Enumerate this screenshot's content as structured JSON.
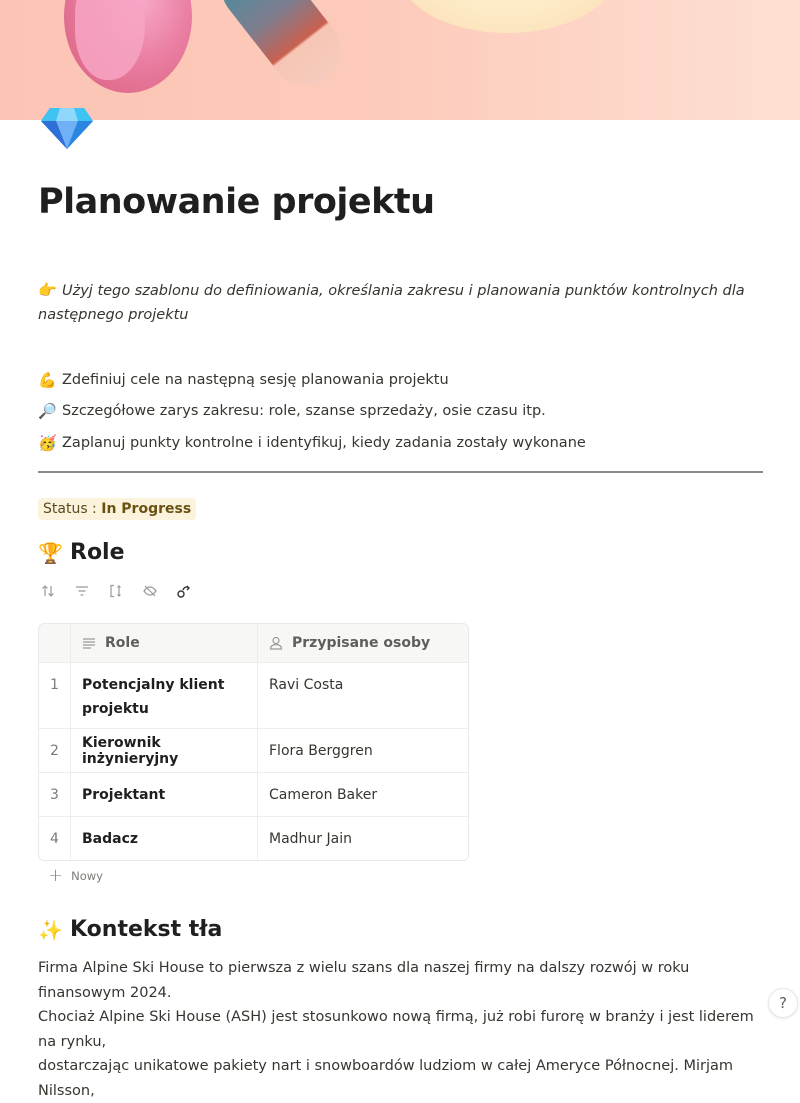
{
  "page": {
    "icon": "gem-icon",
    "title": "Planowanie projektu",
    "intro": {
      "emoji": "👉",
      "text": "Użyj tego szablonu do definiowania, określania zakresu i planowania punktów kontrolnych dla następnego projektu"
    },
    "bullets": [
      {
        "emoji": "💪",
        "text": "Zdefiniuj cele na następną sesję planowania projektu"
      },
      {
        "emoji": "🔎",
        "text": "Szczegółowe zarys zakresu: role, szanse sprzedaży, osie czasu itp."
      },
      {
        "emoji": "🥳",
        "text": "Zaplanuj punkty kontrolne i identyfikuj, kiedy zadania zostały wykonane"
      }
    ],
    "status": {
      "label": "Status : ",
      "value": "In Progress",
      "bg_color": "#fbf3db"
    }
  },
  "roles_section": {
    "emoji": "🏆",
    "heading": "Role",
    "toolbar": [
      {
        "name": "sort-icon"
      },
      {
        "name": "filter-icon"
      },
      {
        "name": "row-height-icon"
      },
      {
        "name": "hide-fields-icon"
      },
      {
        "name": "share-link-icon"
      }
    ],
    "table": {
      "columns": [
        {
          "icon": "text-lines-icon",
          "label": "Role"
        },
        {
          "icon": "person-icon",
          "label": "Przypisane osoby"
        }
      ],
      "rows": [
        {
          "num": "1",
          "role": "Potencjalny klient projektu",
          "person": "Ravi Costa"
        },
        {
          "num": "2",
          "role": "Kierownik inżynieryjny",
          "person": "Flora Berggren"
        },
        {
          "num": "3",
          "role": "Projektant",
          "person": "Cameron Baker"
        },
        {
          "num": "4",
          "role": "Badacz",
          "person": "Madhur Jain"
        }
      ]
    },
    "add_new_label": "Nowy"
  },
  "context_section": {
    "emoji": "✨",
    "heading": "Kontekst tła",
    "paragraph_lines": [
      "Firma Alpine Ski House to pierwsza z wielu szans dla naszej firmy na dalszy rozwój w roku finansowym 2024.",
      "Chociaż Alpine Ski House (ASH) jest stosunkowo nową firmą, już robi furorę w branży i jest liderem na rynku,",
      "dostarczając unikatowe pakiety nart i snowboardów ludziom w całej Ameryce Północnej. Mirjam Nilsson,"
    ]
  },
  "help_button": {
    "label": "?"
  }
}
